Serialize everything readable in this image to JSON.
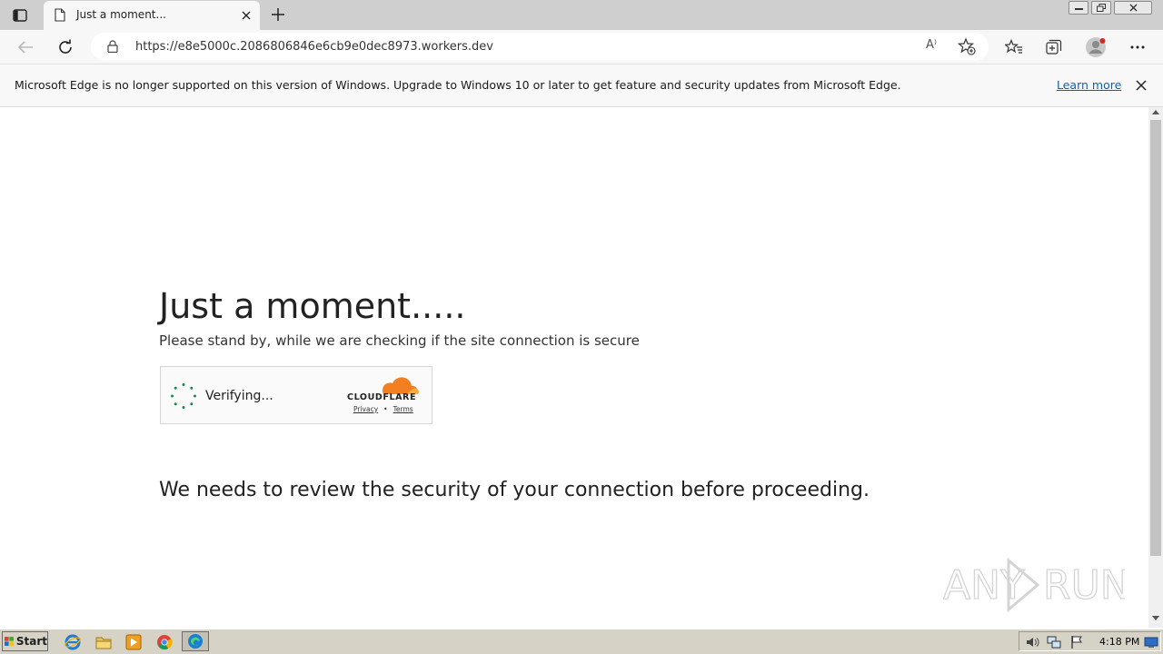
{
  "window": {
    "tab_title": "Just a moment..."
  },
  "toolbar": {
    "url": "https://e8e5000c.2086806846e6cb9e0dec8973.workers.dev",
    "read_aloud_label": "A⁾"
  },
  "infobar": {
    "message": "Microsoft Edge is no longer supported on this version of Windows. Upgrade to Windows 10 or later to get feature and security updates from Microsoft Edge.",
    "link": "Learn more"
  },
  "page": {
    "heading": "Just a moment.....",
    "subheading": "Please stand by, while we are checking if the site connection is secure",
    "widget": {
      "status": "Verifying...",
      "brand": "CLOUDFLARE",
      "privacy": "Privacy",
      "separator": "•",
      "terms": "Terms",
      "brand_color": "#f38020"
    },
    "review_text": "We needs to review the security of your connection before proceeding."
  },
  "watermark": {
    "left": "ANY",
    "right": "RUN"
  },
  "taskbar": {
    "start_label": "Start",
    "clock": "4:18 PM"
  }
}
